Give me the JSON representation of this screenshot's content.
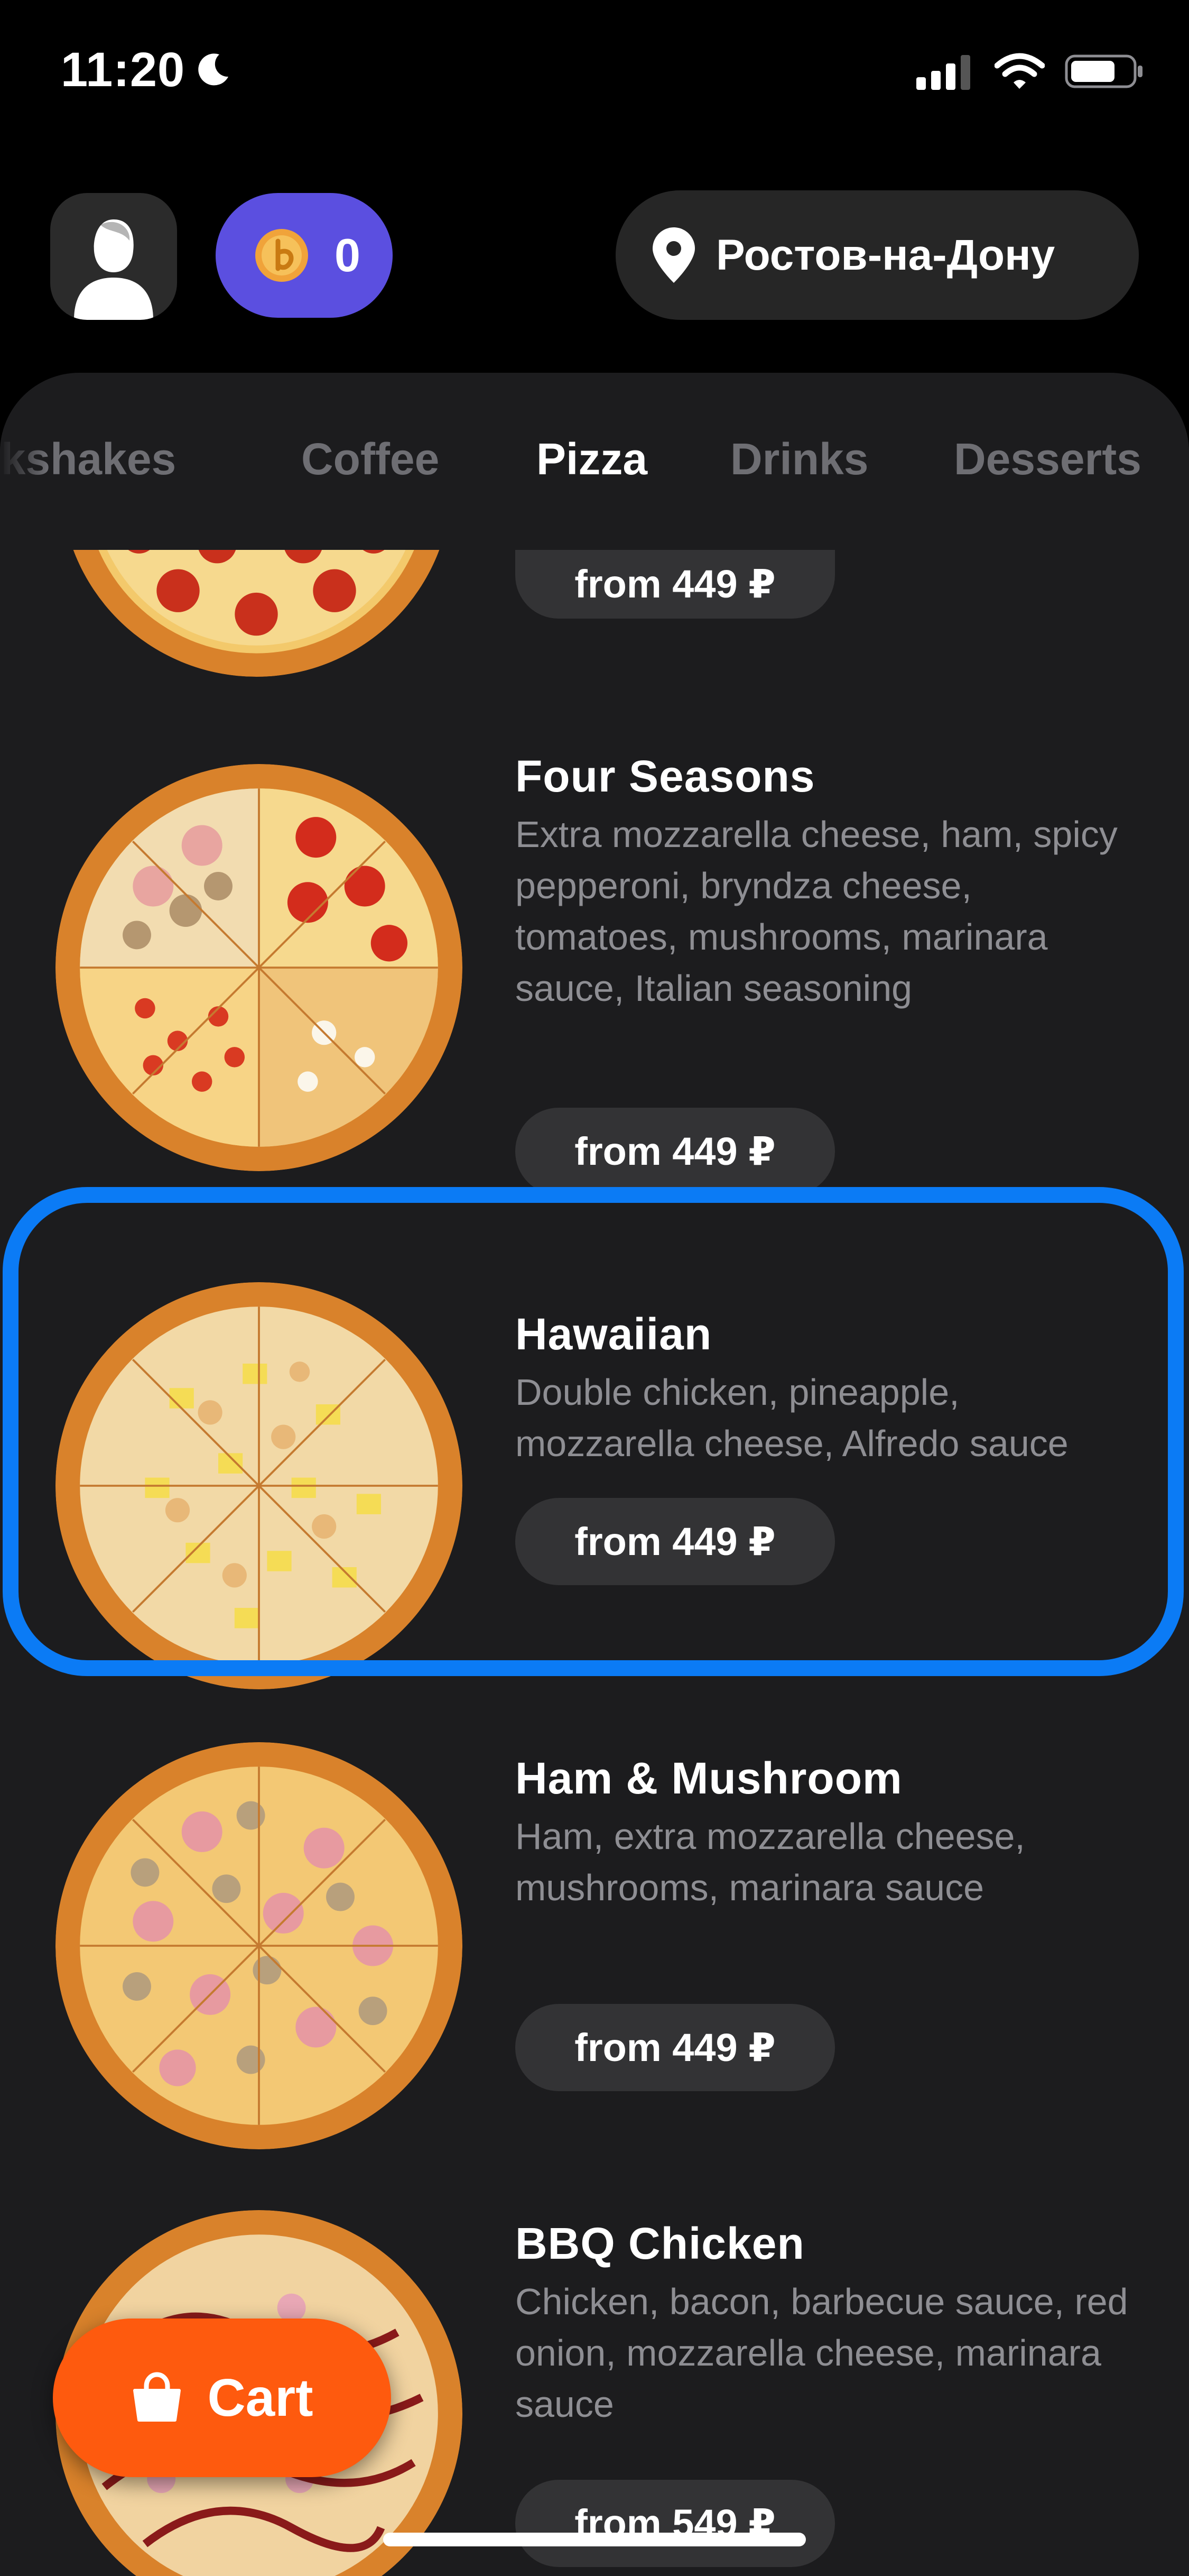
{
  "status_bar": {
    "time": "11:20",
    "icons": [
      "moon-icon",
      "cellular-icon",
      "wifi-icon",
      "battery-icon"
    ]
  },
  "header": {
    "profile_icon": "user-icon",
    "coins": {
      "icon": "coin-icon",
      "count": "0"
    },
    "city": {
      "icon": "location-pin-icon",
      "label": "Ростов-на-Дону"
    }
  },
  "tabs": [
    {
      "label": "Milkshakes"
    },
    {
      "label": "Coffee"
    },
    {
      "label": "Pizza",
      "active": true
    },
    {
      "label": "Drinks"
    },
    {
      "label": "Desserts"
    }
  ],
  "products": [
    {
      "title": "",
      "description": "",
      "price": "from 449 ₽",
      "kind": "pepperoni"
    },
    {
      "title": "Four Seasons",
      "description": "Extra mozzarella cheese, ham, spicy pepperoni, bryndza cheese, tomatoes, mushrooms, marinara sauce, Italian seasoning",
      "price": "from 449 ₽",
      "kind": "four-seasons"
    },
    {
      "title": "Hawaiian",
      "description": "Double chicken, pineapple, mozzarella cheese, Alfredo sauce",
      "price": "from 449 ₽",
      "kind": "hawaiian",
      "highlighted": true
    },
    {
      "title": "Ham & Mushroom",
      "description": "Ham, extra mozzarella cheese, mushrooms, marinara sauce",
      "price": "from 449 ₽",
      "kind": "ham-mushroom"
    },
    {
      "title": "BBQ Chicken",
      "description": "Chicken, bacon, barbecue sauce, red onion, mozzarella cheese, marinara sauce",
      "price": "from 549 ₽",
      "kind": "bbq-chicken"
    }
  ],
  "cart": {
    "label": "Cart",
    "icon": "shopping-bag-icon"
  },
  "colors": {
    "accent_purple": "#5b4fe0",
    "cart_orange": "#fe5a0e",
    "highlight_blue": "#0b7bf5",
    "panel_bg": "#1c1c1e"
  }
}
